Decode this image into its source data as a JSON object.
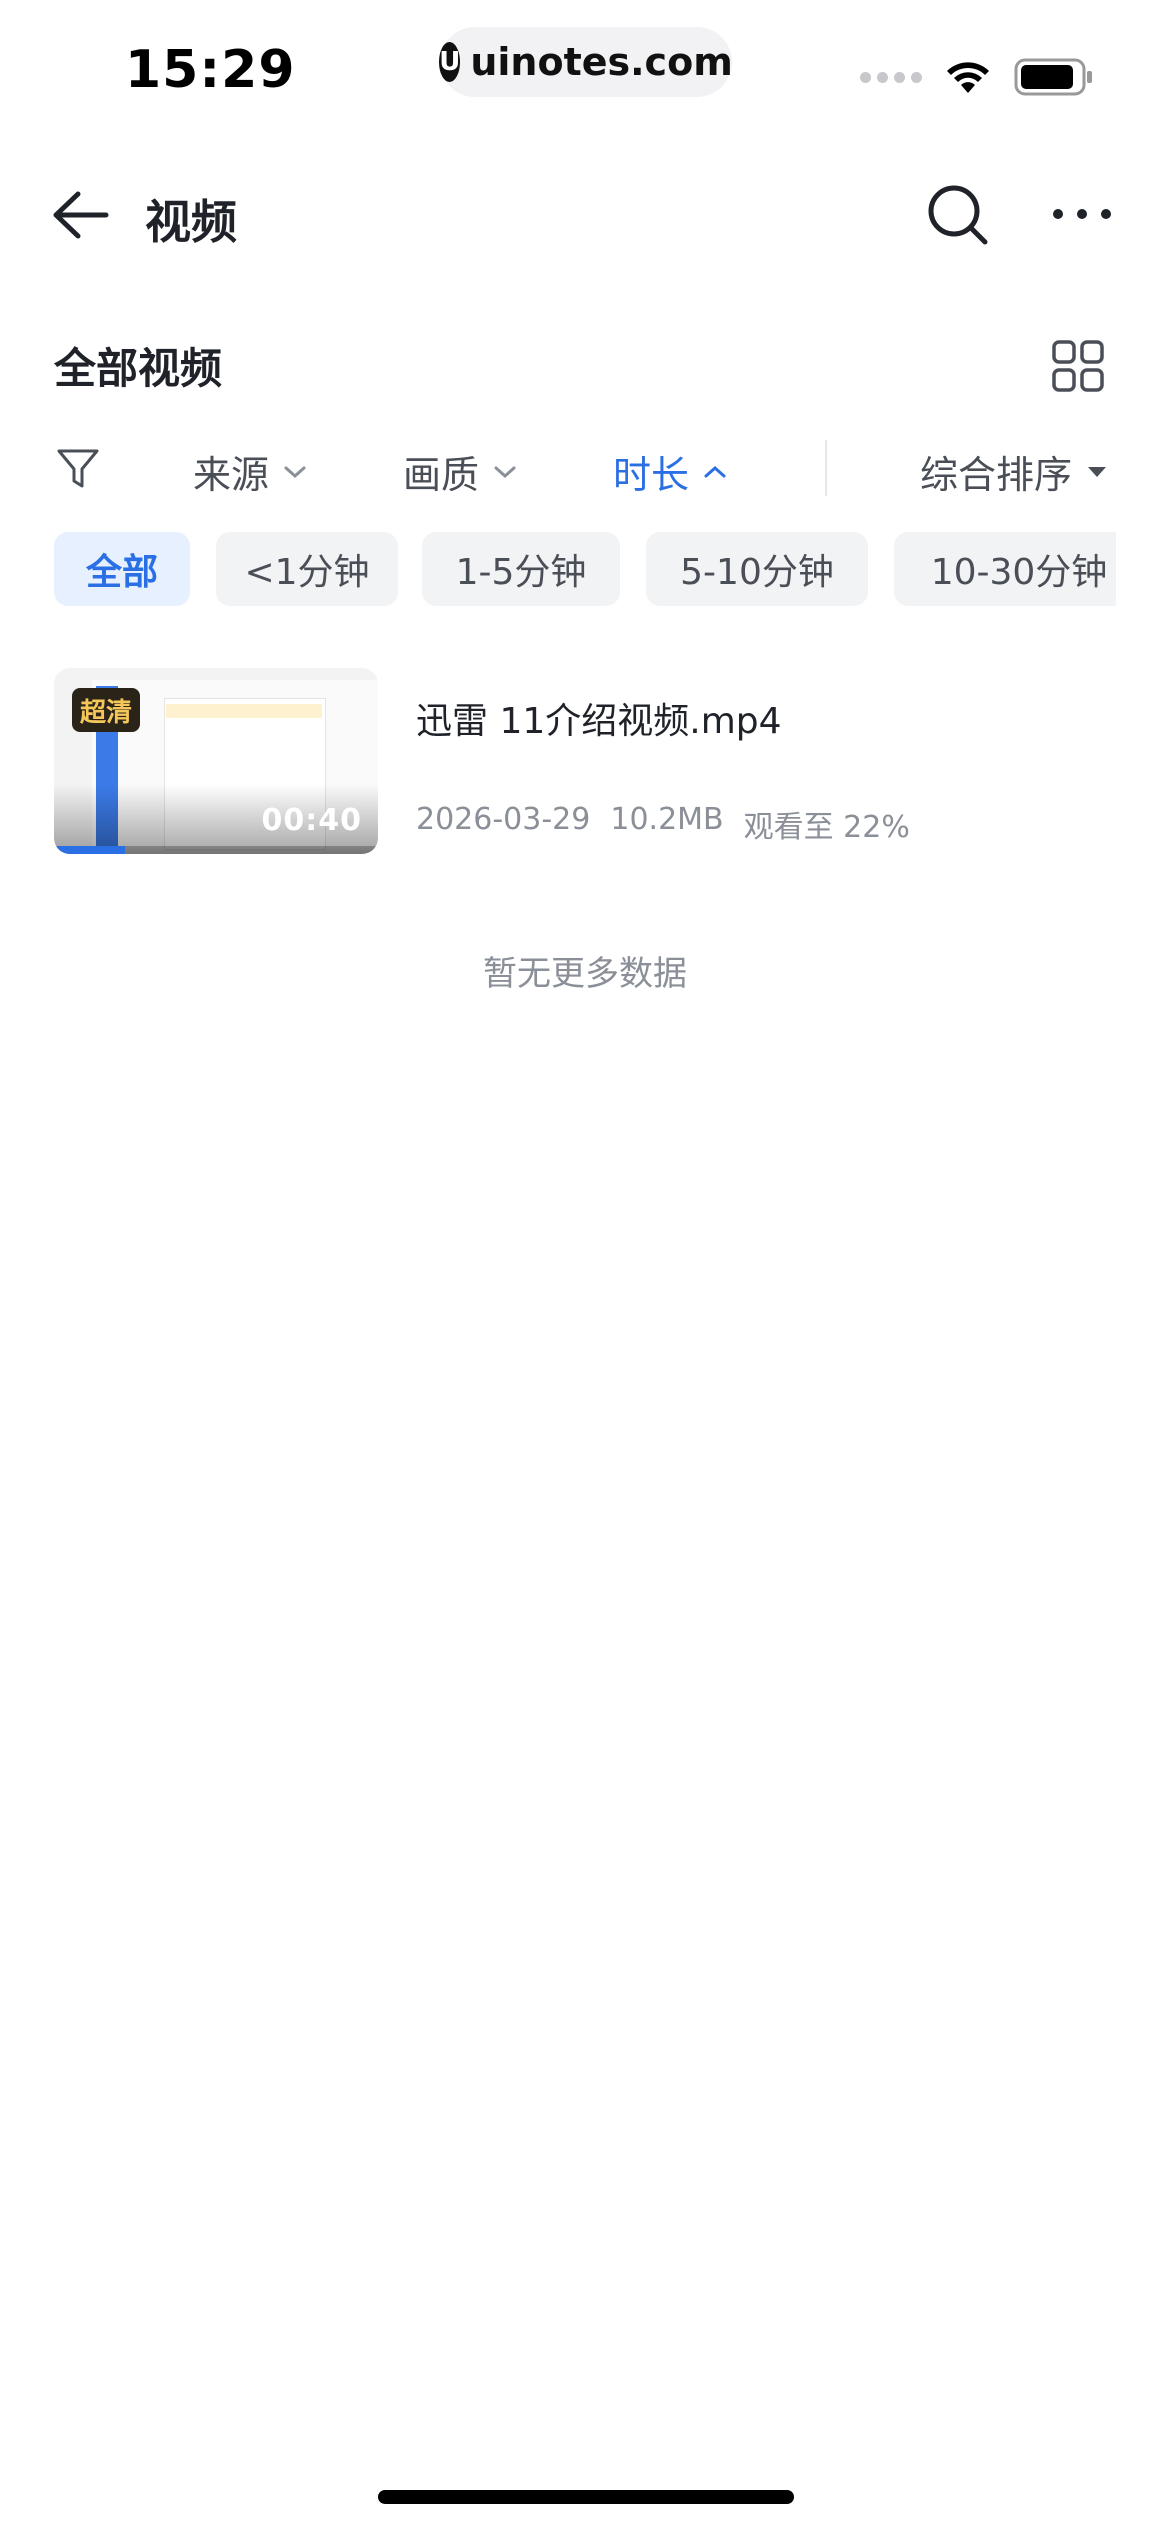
{
  "status_bar": {
    "time": "15:29",
    "url": "uinotes.com",
    "url_logo": "U"
  },
  "header": {
    "title": "视频",
    "icons": [
      "back-icon",
      "search-icon",
      "more-icon"
    ]
  },
  "section": {
    "title": "全部视频",
    "view_icon": "grid-icon"
  },
  "filters": {
    "items": [
      {
        "label": "来源",
        "state": "collapsed"
      },
      {
        "label": "画质",
        "state": "collapsed"
      },
      {
        "label": "时长",
        "state": "expanded"
      }
    ],
    "sort_label": "综合排序",
    "filter_icon": "funnel-icon",
    "active_color": "#2b6fe4"
  },
  "chips": [
    {
      "label": "全部",
      "active": true
    },
    {
      "label": "<1分钟",
      "active": false
    },
    {
      "label": "1-5分钟",
      "active": false
    },
    {
      "label": "5-10分钟",
      "active": false
    },
    {
      "label": "10-30分钟",
      "active": false
    }
  ],
  "videos": [
    {
      "title": "迅雷 11介绍视频.mp4",
      "quality_badge": "超清",
      "duration": "00:40",
      "date": "2026-03-29",
      "size": "10.2MB",
      "progress_text": "观看至 22%",
      "progress_fraction": 0.22
    }
  ],
  "footer_text": "暂无更多数据"
}
